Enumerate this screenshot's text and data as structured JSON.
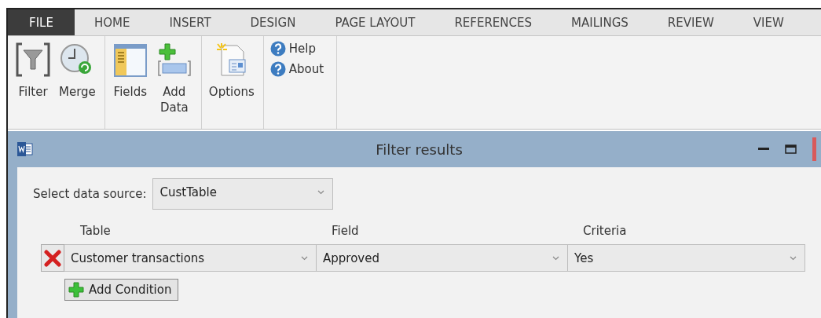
{
  "tabs": [
    {
      "label": "FILE",
      "selected": true
    },
    {
      "label": "HOME",
      "selected": false
    },
    {
      "label": "INSERT",
      "selected": false
    },
    {
      "label": "DESIGN",
      "selected": false
    },
    {
      "label": "PAGE LAYOUT",
      "selected": false
    },
    {
      "label": "REFERENCES",
      "selected": false
    },
    {
      "label": "MAILINGS",
      "selected": false
    },
    {
      "label": "REVIEW",
      "selected": false
    },
    {
      "label": "VIEW",
      "selected": false
    }
  ],
  "ribbon": {
    "groups": [
      {
        "kind": "large",
        "buttons": [
          "Filter",
          "Merge"
        ]
      },
      {
        "kind": "large",
        "buttons": [
          "Fields",
          "Add Data"
        ]
      },
      {
        "kind": "large",
        "buttons": [
          "Options"
        ]
      },
      {
        "kind": "small",
        "buttons": [
          "Help",
          "About"
        ]
      }
    ]
  },
  "dialog": {
    "title": "Filter results",
    "data_source": {
      "label": "Select data source:",
      "value": "CustTable"
    },
    "columns": [
      "Table",
      "Field",
      "Criteria"
    ],
    "conditions": [
      {
        "table": "Customer transactions",
        "field": "Approved",
        "criteria": "Yes"
      }
    ],
    "add_button": "Add Condition"
  }
}
